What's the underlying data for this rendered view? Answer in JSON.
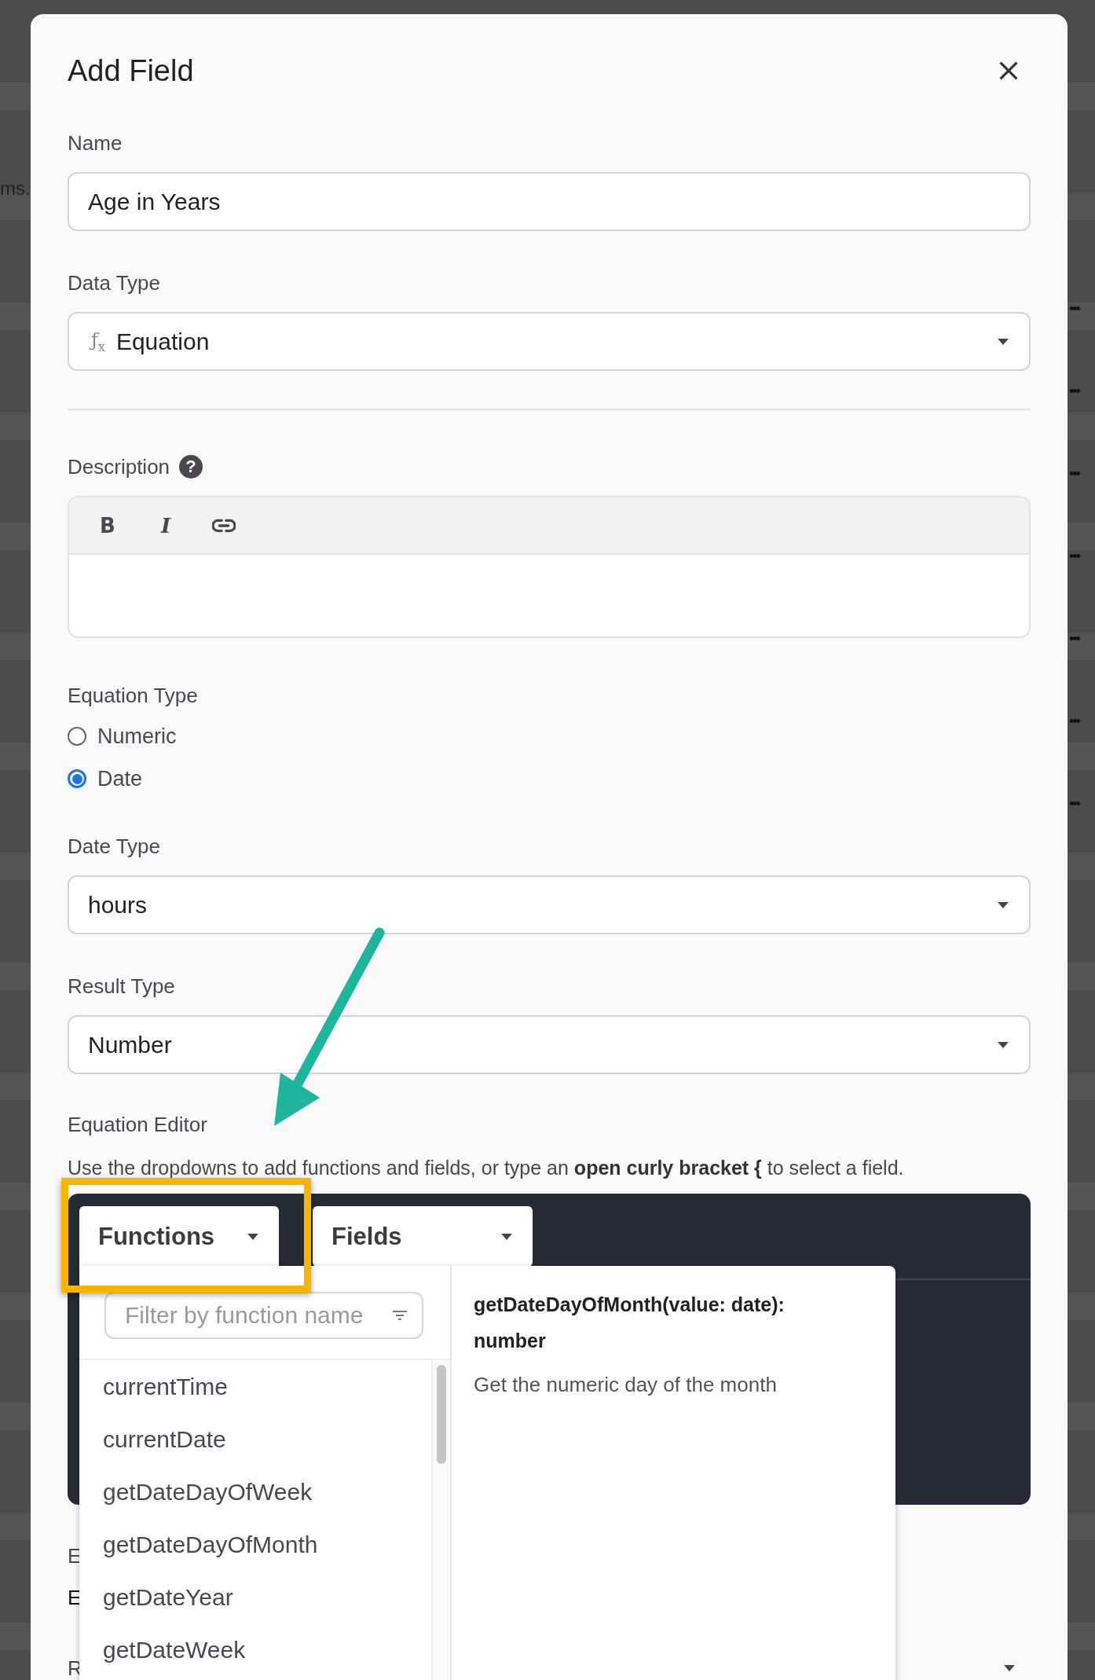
{
  "background": {
    "left_text": "ms.",
    "row_menus": [
      "•••",
      "•••",
      "•••",
      "•••",
      "•••",
      "•••",
      "•••"
    ]
  },
  "dialog": {
    "title": "Add Field",
    "name": {
      "label": "Name",
      "value": "Age in Years"
    },
    "data_type": {
      "label": "Data Type",
      "icon": "ƒ$_{x}$",
      "value": "Equation"
    },
    "description": {
      "label": "Description",
      "help": "?",
      "toolbar": [
        {
          "kind": "bold",
          "label": "B"
        },
        {
          "kind": "italic",
          "label": "I"
        },
        {
          "kind": "link"
        }
      ]
    },
    "equation_type": {
      "label": "Equation Type",
      "options": [
        {
          "label": "Numeric",
          "selected": false
        },
        {
          "label": "Date",
          "selected": true
        }
      ]
    },
    "date_type": {
      "label": "Date Type",
      "value": "hours"
    },
    "result_type": {
      "label": "Result Type",
      "value": "Number"
    },
    "equation_editor": {
      "label": "Equation Editor",
      "help": "Use the dropdowns to add functions and fields, or type an **open curly bracket {** to select a field.",
      "menus": [
        {
          "label": "Functions",
          "expanded": true
        },
        {
          "label": "Fields",
          "expanded": false
        }
      ],
      "functions_dropdown": {
        "placeholder": "Filter by function name",
        "items": [
          "currentTime",
          "currentDate",
          "getDateDayOfWeek",
          "getDateDayOfMonth",
          "getDateYear",
          "getDateWeek"
        ],
        "detail": {
          "signature": "getDateDayOfMonth(value: date): number",
          "description": "Get the numeric day of the month"
        }
      }
    },
    "covered_labels": [
      "E",
      "E",
      "R"
    ]
  }
}
